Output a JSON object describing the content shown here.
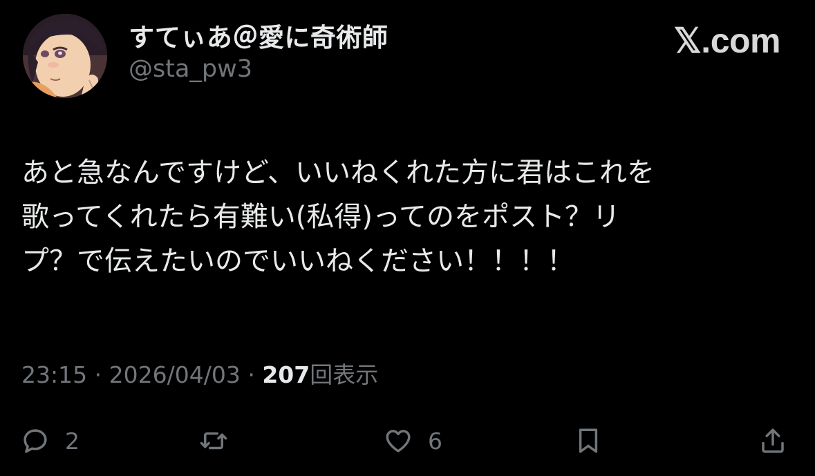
{
  "user": {
    "display_name": "すてぃあ＠愛に奇術師",
    "handle": "@sta_pw3",
    "avatar": "avatar-illustration"
  },
  "brand": "𝕏.com",
  "tweet": {
    "lines": [
      "あと急なんですけど、いいねくれた方に君はこれを",
      "歌ってくれたら有難い(私得)ってのをポスト？リ",
      "プ？で伝えたいのでいいねください！！！！"
    ]
  },
  "meta": {
    "time": "23:15",
    "separator": "·",
    "date": "2026/04/03",
    "views_count": "207",
    "views_label": "回表示"
  },
  "actions": {
    "reply": {
      "icon": "reply-icon",
      "count": "2"
    },
    "repost": {
      "icon": "repost-icon"
    },
    "like": {
      "icon": "heart-icon",
      "count": "6"
    },
    "bookmark": {
      "icon": "bookmark-icon"
    },
    "share": {
      "icon": "share-icon"
    }
  },
  "colors": {
    "background": "#000000",
    "text": "#e7e9ea",
    "muted": "#71767b"
  }
}
